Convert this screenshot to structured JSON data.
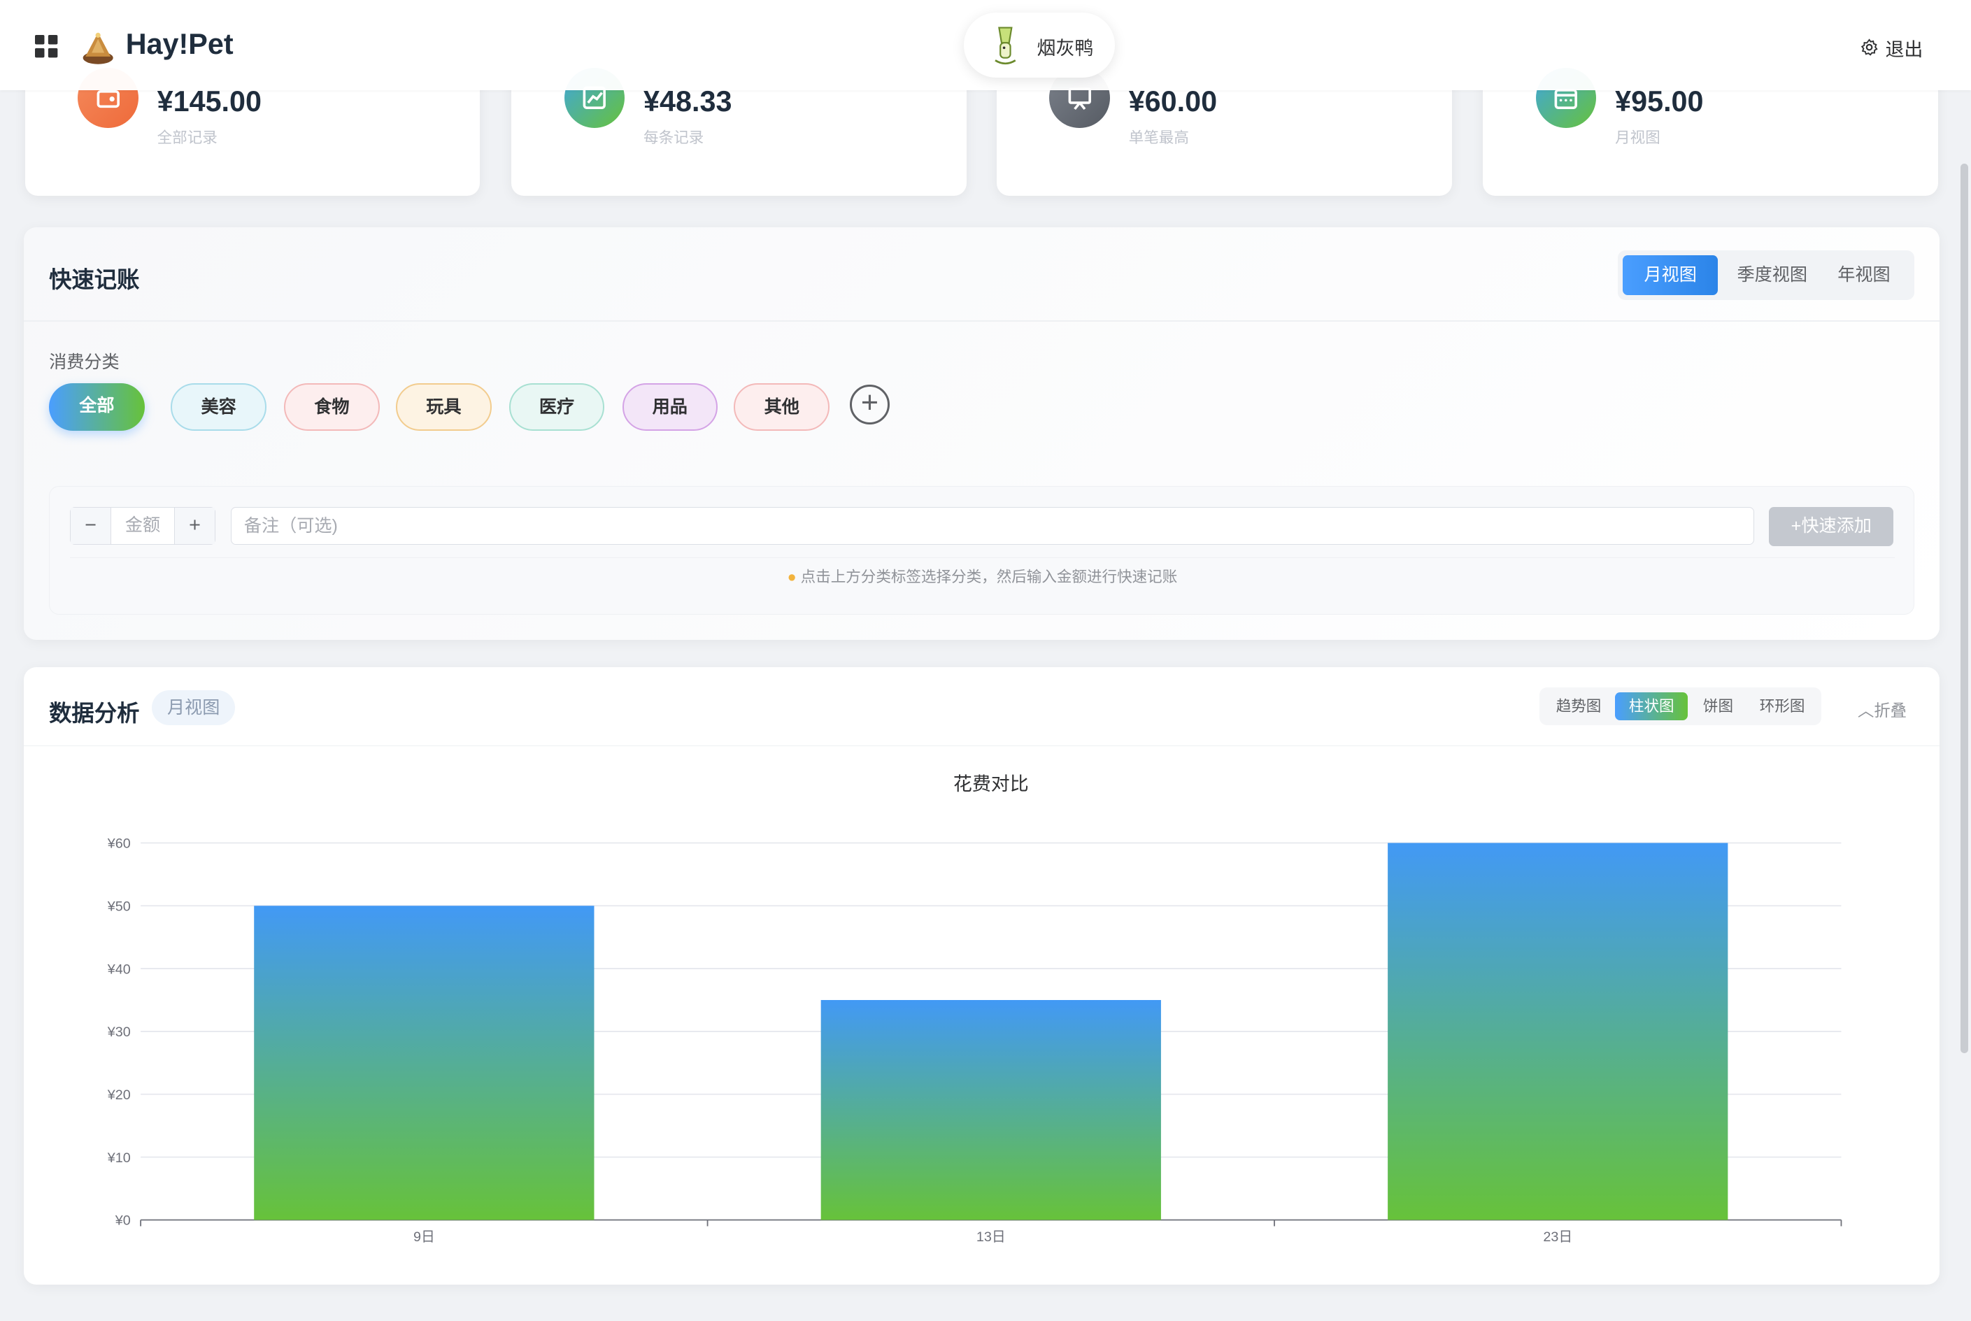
{
  "header": {
    "brand": "Hay!Pet",
    "user_name": "烟灰鸭",
    "logout_label": "退出"
  },
  "stats": [
    {
      "value": "¥145.00",
      "label": "全部记录",
      "icon": "wallet-icon",
      "color": "#f0784a"
    },
    {
      "value": "¥48.33",
      "label": "每条记录",
      "icon": "trend-chart-icon",
      "color": "#3fa6e0"
    },
    {
      "value": "¥60.00",
      "label": "单笔最高",
      "icon": "presentation-icon",
      "color": "#6b7280"
    },
    {
      "value": "¥95.00",
      "label": "月视图",
      "icon": "calendar-icon",
      "color": "#3fa6e0"
    }
  ],
  "quick": {
    "title": "快速记账",
    "views": [
      "月视图",
      "季度视图",
      "年视图"
    ],
    "active_view": "月视图",
    "category_label": "消费分类",
    "categories": [
      {
        "label": "全部",
        "bg": "#4a9eff",
        "border": "#4a9eff",
        "active": true
      },
      {
        "label": "美容",
        "bg": "#e8f6fa",
        "border": "#a9dcea"
      },
      {
        "label": "食物",
        "bg": "#fdeeee",
        "border": "#f3b9b9"
      },
      {
        "label": "玩具",
        "bg": "#fdf3e3",
        "border": "#f2cc8e"
      },
      {
        "label": "医疗",
        "bg": "#e9f7f4",
        "border": "#a8e0d2"
      },
      {
        "label": "用品",
        "bg": "#f3e6f8",
        "border": "#d4a3e6"
      },
      {
        "label": "其他",
        "bg": "#fdeeee",
        "border": "#f3b9b9"
      }
    ],
    "amount_placeholder": "金额",
    "minus": "−",
    "plus": "+",
    "note_placeholder": "备注（可选)",
    "add_button": "+快速添加",
    "hint": "点击上方分类标签选择分类，然后输入金额进行快速记账"
  },
  "analysis": {
    "title": "数据分析",
    "view_badge": "月视图",
    "chart_types": [
      "趋势图",
      "柱状图",
      "饼图",
      "环形图"
    ],
    "active_chart_type": "柱状图",
    "collapse_label": "折叠"
  },
  "chart_data": {
    "type": "bar",
    "title": "花费对比",
    "categories": [
      "9日",
      "13日",
      "23日"
    ],
    "values": [
      50,
      35,
      60
    ],
    "ylim": [
      0,
      60
    ],
    "yticks": [
      0,
      10,
      20,
      30,
      40,
      50,
      60
    ],
    "ytick_labels": [
      "¥0",
      "¥10",
      "¥20",
      "¥30",
      "¥40",
      "¥50",
      "¥60"
    ],
    "grid": true,
    "colors": {
      "top": "#4299f5",
      "bottom": "#67c23a"
    }
  }
}
